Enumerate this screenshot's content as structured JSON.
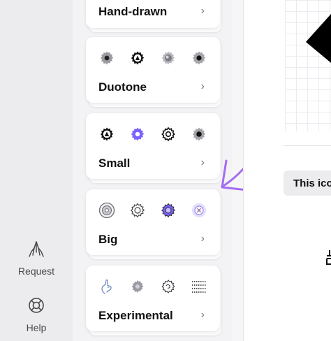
{
  "sidebar": {
    "items": [
      {
        "label": "Request",
        "icon": "praying-hands-icon"
      },
      {
        "label": "Help",
        "icon": "lifebuoy-icon"
      }
    ]
  },
  "styles": [
    {
      "title": "Hand-drawn",
      "icons": []
    },
    {
      "title": "Duotone",
      "icons": [
        "gear-duotone-gray-icon",
        "gear-duotone-outline-icon",
        "gear-duotone-shaded-icon",
        "gear-duotone-dot-icon"
      ]
    },
    {
      "title": "Small",
      "icons": [
        "gear-small-outline-icon",
        "gear-small-purple-icon",
        "gear-small-thin-icon",
        "gear-small-solid-icon"
      ]
    },
    {
      "title": "Big",
      "icons": [
        "gear-big-circle-icon",
        "gear-big-outline-icon",
        "gear-big-purple-icon",
        "gear-big-color-icon"
      ]
    },
    {
      "title": "Experimental",
      "icons": [
        "hand-experimental-icon",
        "gear-experimental-sketch-icon",
        "gear-experimental-outline-icon",
        "dotted-lines-experimental-icon"
      ]
    }
  ],
  "chevron": "›",
  "tooltip": "This ico",
  "colors": {
    "accent": "#7b61ff",
    "annotation_arrow": "#a46cf2"
  }
}
